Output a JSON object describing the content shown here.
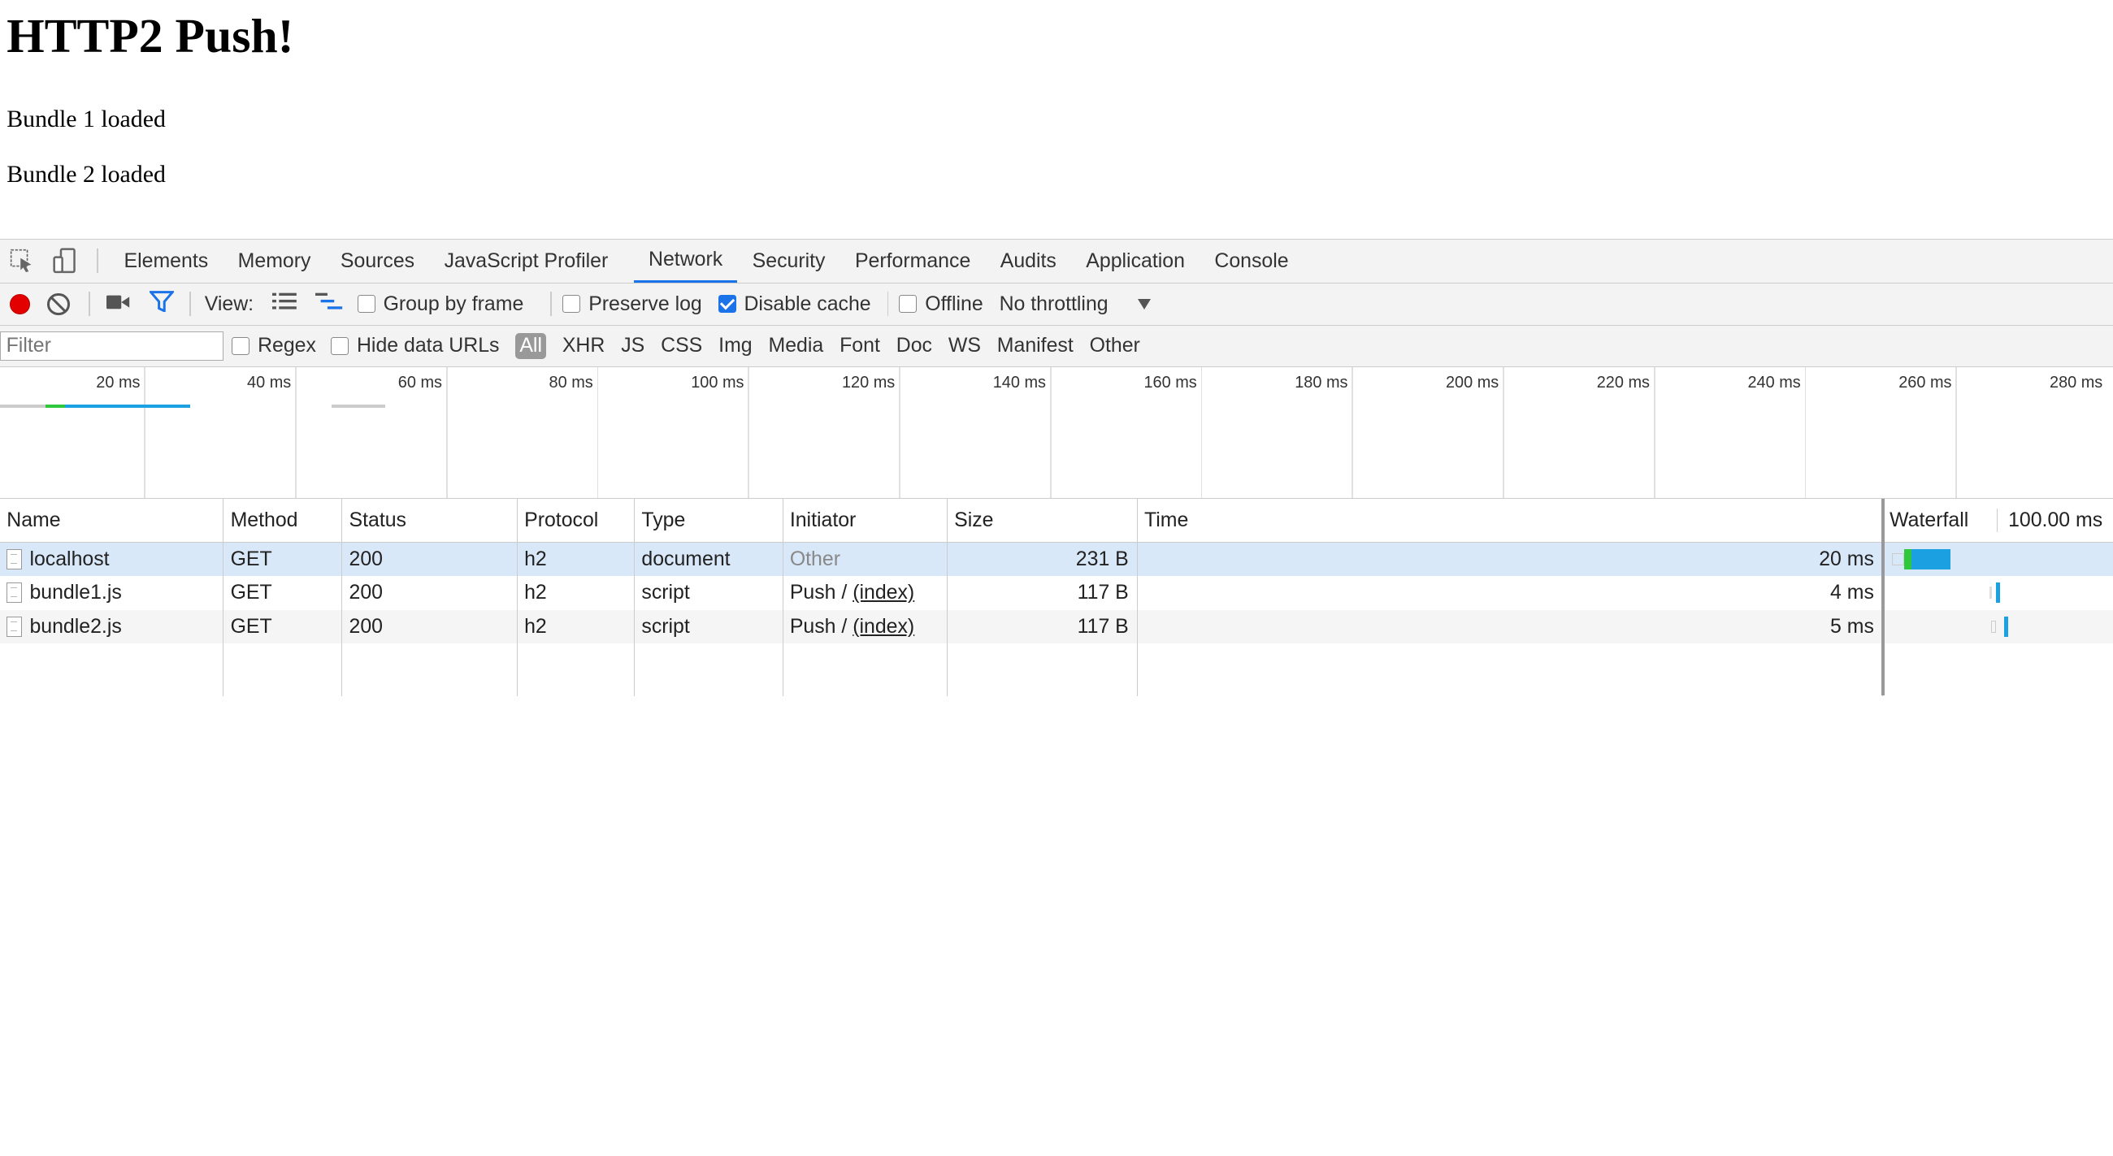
{
  "page": {
    "heading": "HTTP2 Push!",
    "lines": [
      "Bundle 1 loaded",
      "Bundle 2 loaded"
    ]
  },
  "devtools": {
    "tabs": [
      "Elements",
      "Memory",
      "Sources",
      "JavaScript Profiler",
      "Network",
      "Security",
      "Performance",
      "Audits",
      "Application",
      "Console"
    ],
    "active_tab": "Network",
    "toolbar": {
      "view_label": "View:",
      "group_by_frame": "Group by frame",
      "preserve_log": "Preserve log",
      "disable_cache": "Disable cache",
      "offline": "Offline",
      "throttling": "No throttling"
    },
    "filterbar": {
      "placeholder": "Filter",
      "regex": "Regex",
      "hide_data_urls": "Hide data URLs",
      "all": "All",
      "types": [
        "XHR",
        "JS",
        "CSS",
        "Img",
        "Media",
        "Font",
        "Doc",
        "WS",
        "Manifest",
        "Other"
      ]
    },
    "overview_ticks": [
      "20 ms",
      "40 ms",
      "60 ms",
      "80 ms",
      "100 ms",
      "120 ms",
      "140 ms",
      "160 ms",
      "180 ms",
      "200 ms",
      "220 ms",
      "240 ms",
      "260 ms",
      "280 ms"
    ],
    "table": {
      "columns": [
        "Name",
        "Method",
        "Status",
        "Protocol",
        "Type",
        "Initiator",
        "Size",
        "Time",
        "Waterfall"
      ],
      "waterfall_scale": "100.00 ms",
      "rows": [
        {
          "name": "localhost",
          "method": "GET",
          "status": "200",
          "protocol": "h2",
          "type": "document",
          "initiator": "Other",
          "initiator_link": "",
          "size": "231 B",
          "time": "20 ms"
        },
        {
          "name": "bundle1.js",
          "method": "GET",
          "status": "200",
          "protocol": "h2",
          "type": "script",
          "initiator": "Push / ",
          "initiator_link": "(index)",
          "size": "117 B",
          "time": "4 ms"
        },
        {
          "name": "bundle2.js",
          "method": "GET",
          "status": "200",
          "protocol": "h2",
          "type": "script",
          "initiator": "Push / ",
          "initiator_link": "(index)",
          "size": "117 B",
          "time": "5 ms"
        }
      ]
    },
    "colors": {
      "accent": "#1a73e8",
      "record": "#e20000",
      "bar_blue": "#1ba1e2",
      "bar_green": "#2fc83c",
      "selected_row": "#d9e8f9"
    }
  }
}
